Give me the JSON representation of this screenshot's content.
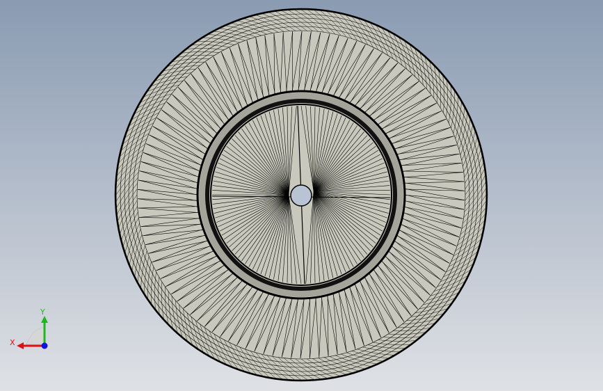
{
  "viewport": {
    "background_top": "#8a9bb2",
    "background_bottom": "#dfe1e5"
  },
  "model": {
    "face_color": "#c8c8bc",
    "edge_color": "#000000",
    "rim_color": "#a4a49a"
  },
  "triad": {
    "x_label": "X",
    "y_label": "Y",
    "x_color": "#e01010",
    "y_color": "#1db81d",
    "z_color": "#1010e0"
  }
}
